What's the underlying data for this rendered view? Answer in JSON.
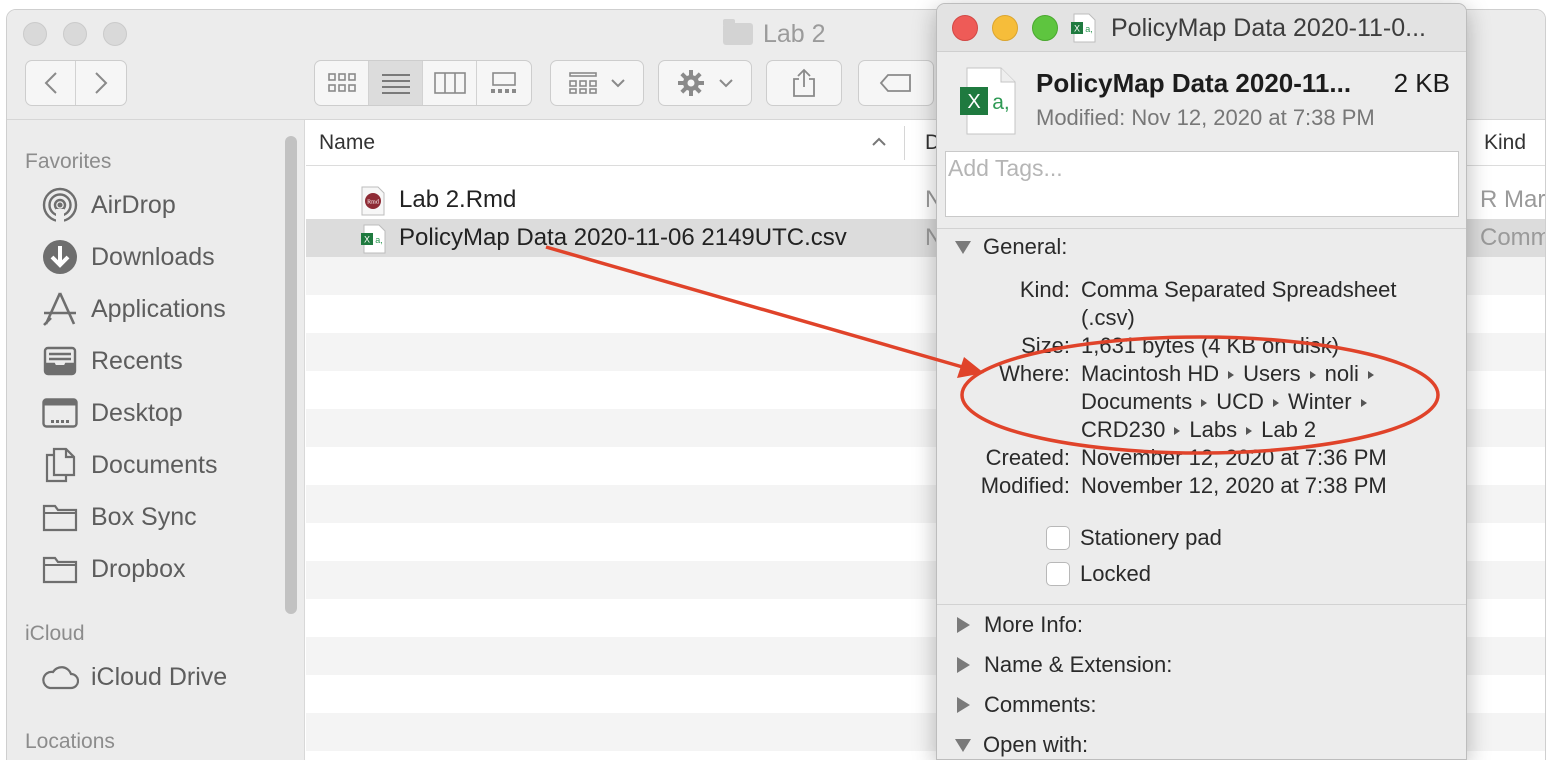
{
  "finder": {
    "window_title": "Lab 2",
    "sidebar": {
      "favorites_heading": "Favorites",
      "favorites": [
        {
          "label": "AirDrop",
          "icon": "airdrop-icon"
        },
        {
          "label": "Downloads",
          "icon": "downloads-icon"
        },
        {
          "label": "Applications",
          "icon": "applications-icon"
        },
        {
          "label": "Recents",
          "icon": "recents-icon"
        },
        {
          "label": "Desktop",
          "icon": "desktop-icon"
        },
        {
          "label": "Documents",
          "icon": "documents-icon"
        },
        {
          "label": "Box Sync",
          "icon": "folder-icon"
        },
        {
          "label": "Dropbox",
          "icon": "folder-icon"
        }
      ],
      "icloud_heading": "iCloud",
      "icloud": [
        {
          "label": "iCloud Drive",
          "icon": "cloud-icon"
        }
      ],
      "locations_heading": "Locations"
    },
    "columns": {
      "name": "Name",
      "date_partial": "D",
      "kind": "Kind"
    },
    "files": [
      {
        "name": "Lab 2.Rmd",
        "date_partial": "N",
        "kind": "R Mar",
        "icon": "rmd-file-icon"
      },
      {
        "name": "PolicyMap Data 2020-11-06 2149UTC.csv",
        "date_partial": "N",
        "kind": "Comm",
        "icon": "csv-file-icon"
      }
    ]
  },
  "info": {
    "title": "PolicyMap Data 2020-11-0...",
    "file_name": "PolicyMap Data 2020-11...",
    "size": "2 KB",
    "modified_summary": "Modified: Nov 12, 2020 at 7:38 PM",
    "tags_placeholder": "Add Tags...",
    "general_heading": "General:",
    "general": {
      "kind_label": "Kind:",
      "kind_line1": "Comma Separated Spreadsheet",
      "kind_line2": "(.csv)",
      "size_label": "Size:",
      "size_value": "1,631 bytes (4 KB on disk)",
      "where_label": "Where:",
      "where_path": [
        "Macintosh HD",
        "Users",
        "noli",
        "Documents",
        "UCD",
        "Winter",
        "CRD230",
        "Labs",
        "Lab 2"
      ],
      "created_label": "Created:",
      "created_value": "November 12, 2020 at 7:36 PM",
      "modified_label": "Modified:",
      "modified_value": "November 12, 2020 at 7:38 PM"
    },
    "checkboxes": [
      {
        "label": "Stationery pad",
        "checked": false
      },
      {
        "label": "Locked",
        "checked": false
      }
    ],
    "sections": [
      "More Info:",
      "Name & Extension:",
      "Comments:",
      "Open with:"
    ]
  },
  "colors": {
    "annotation": "#e0432a",
    "close": "#ee5b57",
    "minimize": "#f6bd3a",
    "zoom": "#5ec53f"
  }
}
